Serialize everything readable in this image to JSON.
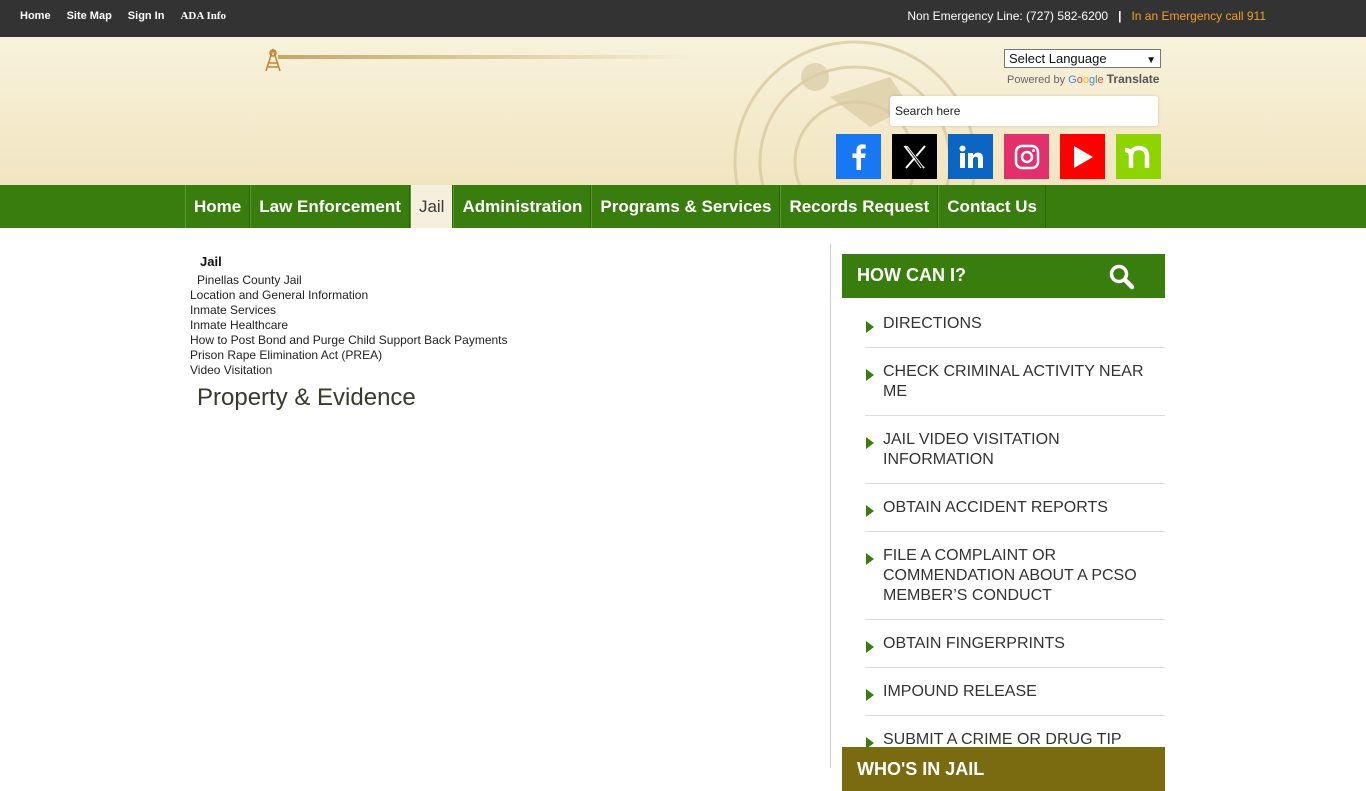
{
  "topbar": {
    "links": [
      "Home",
      "Site Map",
      "Sign In",
      "ADA Info"
    ],
    "non_emergency": "Non Emergency Line: (727) 582-6200",
    "separator": "|",
    "emergency": "In an Emergency call 911"
  },
  "header": {
    "language_select": "Select Language",
    "powered_by": "Powered by",
    "google": [
      "G",
      "o",
      "o",
      "g",
      "l",
      "e"
    ],
    "translate": "Translate",
    "search_placeholder": "Search here",
    "socials": [
      "facebook-icon",
      "x-icon",
      "linkedin-icon",
      "instagram-icon",
      "youtube-icon",
      "nextdoor-icon"
    ]
  },
  "nav": {
    "items": [
      "Home",
      "Law Enforcement",
      "Jail",
      "Administration",
      "Programs & Services",
      "Records Request",
      "Contact Us"
    ],
    "active": "Jail"
  },
  "content": {
    "section": "Jail",
    "menu": [
      "Pinellas County Jail",
      "Location and General Information",
      "Inmate Services",
      "Inmate Healthcare",
      "How to Post Bond and Purge Child Support Back Payments",
      "Prison Rape Elimination Act (PREA)",
      "Video Visitation"
    ],
    "page_title": "Property & Evidence"
  },
  "sidebar": {
    "how_can_i": "HOW CAN I?",
    "items": [
      "DIRECTIONS",
      "CHECK CRIMINAL ACTIVITY NEAR ME",
      "JAIL VIDEO VISITATION INFORMATION",
      "OBTAIN ACCIDENT REPORTS",
      "FILE A COMPLAINT OR COMMENDATION ABOUT A PCSO MEMBER’S CONDUCT",
      "OBTAIN FINGERPRINTS",
      "IMPOUND RELEASE",
      "SUBMIT A CRIME OR DRUG TIP"
    ],
    "whos_in_jail": "WHO'S IN JAIL"
  },
  "colors": {
    "nav_green": "#3a7d0f",
    "topbar": "#333333",
    "emergency_orange": "#f29d2a",
    "whos_in_jail": "#7a6a10"
  }
}
